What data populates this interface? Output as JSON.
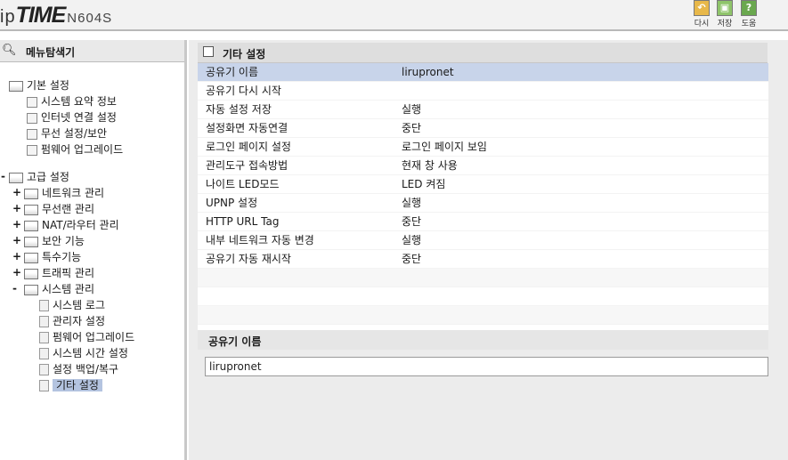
{
  "brand": {
    "ip": "ip",
    "time": "TIME",
    "model": "N604S"
  },
  "toolbar": {
    "undo_label": "다시",
    "save_label": "저장",
    "help_label": "도움",
    "colors": {
      "undo": "#e8b84a",
      "save": "#8fc46a",
      "help": "#6aa84f"
    }
  },
  "sidebar": {
    "title": "메뉴탐색기",
    "basic": {
      "label": "기본 설정",
      "items": [
        "시스템 요약 정보",
        "인터넷 연결 설정",
        "무선 설정/보안",
        "펌웨어 업그레이드"
      ]
    },
    "advanced": {
      "collapse_symbol": "-",
      "label": "고급 설정",
      "groups": [
        {
          "label": "네트워크 관리",
          "symbol": "+"
        },
        {
          "label": "무선랜 관리",
          "symbol": "+"
        },
        {
          "label": "NAT/라우터 관리",
          "symbol": "+"
        },
        {
          "label": "보안 기능",
          "symbol": "+"
        },
        {
          "label": "특수기능",
          "symbol": "+"
        },
        {
          "label": "트래픽 관리",
          "symbol": "+"
        },
        {
          "label": "시스템 관리",
          "symbol": "-"
        }
      ],
      "system_items": [
        "시스템 로그",
        "관리자 설정",
        "펌웨어 업그레이드",
        "시스템 시간 설정",
        "설정 백업/복구",
        "기타 설정"
      ],
      "selected": "기타 설정"
    }
  },
  "main": {
    "title": "기타 설정",
    "rows": [
      {
        "key": "공유기 이름",
        "value": "lirupronet"
      },
      {
        "key": "공유기 다시 시작",
        "value": ""
      },
      {
        "key": "자동 설정 저장",
        "value": "실행"
      },
      {
        "key": "설정화면 자동연결",
        "value": "중단"
      },
      {
        "key": "로그인 페이지 설정",
        "value": "로그인 페이지 보임"
      },
      {
        "key": "관리도구 접속방법",
        "value": "현재 창 사용"
      },
      {
        "key": "나이트 LED모드",
        "value": "LED 켜짐"
      },
      {
        "key": "UPNP 설정",
        "value": "실행"
      },
      {
        "key": "HTTP URL Tag",
        "value": "중단"
      },
      {
        "key": "내부 네트워크 자동 변경",
        "value": "실행"
      },
      {
        "key": "공유기 자동 재시작",
        "value": "중단"
      }
    ],
    "detail": {
      "title": "공유기 이름",
      "value": "lirupronet"
    }
  }
}
